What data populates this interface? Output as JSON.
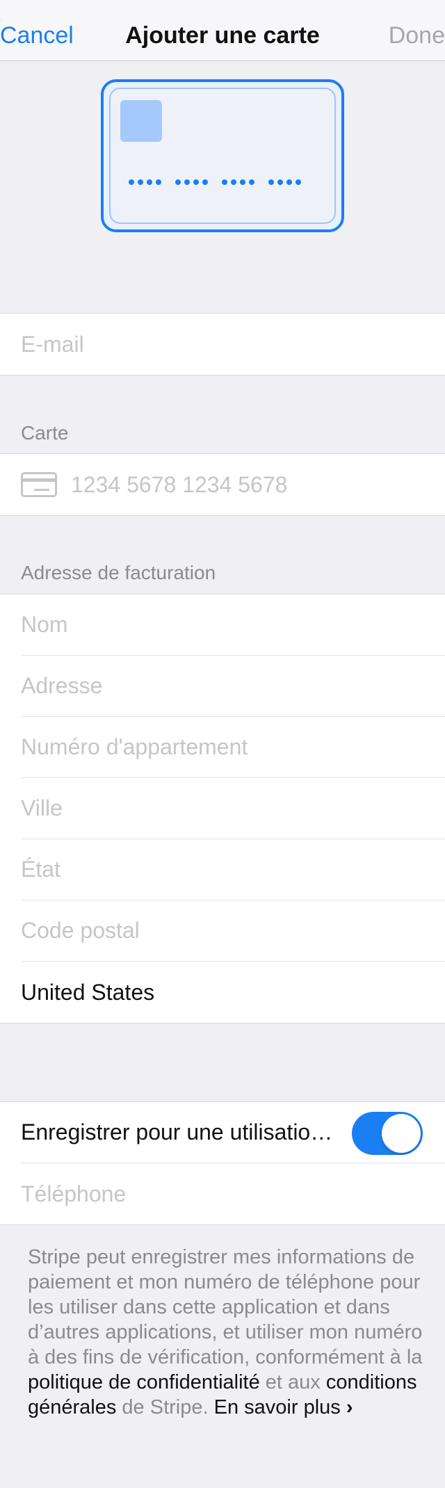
{
  "navbar": {
    "cancel_label": "Cancel",
    "title": "Ajouter une carte",
    "done_label": "Done"
  },
  "email": {
    "placeholder": "E-mail"
  },
  "card_section": {
    "header": "Carte",
    "number_placeholder": "1234 5678 1234 5678",
    "icon": "credit-card-icon"
  },
  "billing": {
    "header": "Adresse de facturation",
    "fields": [
      {
        "placeholder": "Nom"
      },
      {
        "placeholder": "Adresse"
      },
      {
        "placeholder": "Numéro d'appartement"
      },
      {
        "placeholder": "Ville"
      },
      {
        "placeholder": "État"
      },
      {
        "placeholder": "Code postal"
      }
    ],
    "country": "United States"
  },
  "link": {
    "save_label": "Enregistrer pour une utilisatio…",
    "save_enabled": true,
    "phone_placeholder": "Téléphone"
  },
  "footer": {
    "text_1": "Stripe peut enregistrer mes informations de paiement et mon numéro de téléphone pour les utiliser dans cette application et dans d’autres applications, et utiliser mon numéro à des fins de vérification, conformément à la ",
    "privacy_link": "politique de confidentialité",
    "text_2": " et aux ",
    "terms_link": "conditions générales",
    "text_3": " de Stripe. ",
    "learn_more": "En savoir plus",
    "chevron": "›"
  },
  "colors": {
    "accent": "#1a7ff3",
    "background": "#f0f0f4",
    "placeholder": "#c5c5ca"
  }
}
